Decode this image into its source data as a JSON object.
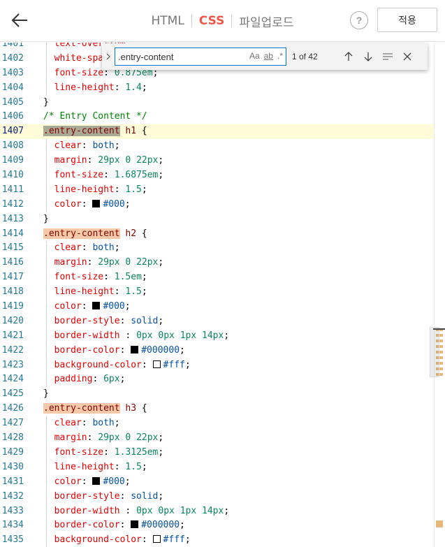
{
  "header": {
    "tabs": [
      {
        "label": "HTML",
        "active": false
      },
      {
        "label": "CSS",
        "active": true
      },
      {
        "label": "파일업로드",
        "active": false
      }
    ],
    "help_label": "?",
    "apply_label": "적용"
  },
  "find": {
    "query": ".entry-content",
    "opt_case": "Aa",
    "opt_word": "ab",
    "opt_regex": ".*",
    "count": "1 of 42"
  },
  "colors": {
    "accent": "#f1564b",
    "match_highlight": "#f8c9a8",
    "current_match": "#a9a995",
    "current_line": "#fdfbd8"
  },
  "editor": {
    "lines": [
      {
        "n": "1401",
        "html": "  <span class='t-prop'>text-overflow</span>"
      },
      {
        "n": "1402",
        "html": "  <span class='t-prop'>white-space</span>"
      },
      {
        "n": "1403",
        "html": "  <span class='t-prop'>font-size</span>: <span class='t-num'>0.875em</span>;"
      },
      {
        "n": "1404",
        "html": "  <span class='t-prop'>line-height</span>: <span class='t-num'>1.4</span>;"
      },
      {
        "n": "1405",
        "html": "}"
      },
      {
        "n": "1406",
        "html": "<span class='t-com'>/* Entry Content */</span>"
      },
      {
        "n": "1407",
        "current": true,
        "html": "<span class='t-sel hl-cur'>.entry-content</span><span class='t-sel'> h1</span> {"
      },
      {
        "n": "1408",
        "html": "  <span class='t-prop'>clear</span>: <span class='t-kw'>both</span>;"
      },
      {
        "n": "1409",
        "html": "  <span class='t-prop'>margin</span>: <span class='t-num'>29px</span> <span class='t-num'>0</span> <span class='t-num'>22px</span>;"
      },
      {
        "n": "1410",
        "html": "  <span class='t-prop'>font-size</span>: <span class='t-num'>1.6875em</span>;"
      },
      {
        "n": "1411",
        "html": "  <span class='t-prop'>line-height</span>: <span class='t-num'>1.5</span>;"
      },
      {
        "n": "1412",
        "html": "  <span class='t-prop'>color</span>: <span class='swatch' style='background:#000'></span><span class='t-kw'>#000</span>;"
      },
      {
        "n": "1413",
        "html": "}"
      },
      {
        "n": "1414",
        "html": "<span class='t-sel hl-match'>.entry-content</span><span class='t-sel'> h2</span> {"
      },
      {
        "n": "1415",
        "html": "  <span class='t-prop'>clear</span>: <span class='t-kw'>both</span>;"
      },
      {
        "n": "1416",
        "html": "  <span class='t-prop'>margin</span>: <span class='t-num'>29px</span> <span class='t-num'>0</span> <span class='t-num'>22px</span>;"
      },
      {
        "n": "1417",
        "html": "  <span class='t-prop'>font-size</span>: <span class='t-num'>1.5em</span>;"
      },
      {
        "n": "1418",
        "html": "  <span class='t-prop'>line-height</span>: <span class='t-num'>1.5</span>;"
      },
      {
        "n": "1419",
        "html": "  <span class='t-prop'>color</span>: <span class='swatch' style='background:#000'></span><span class='t-kw'>#000</span>;"
      },
      {
        "n": "1420",
        "html": "  <span class='t-prop'>border-style</span>: <span class='t-kw'>solid</span>;"
      },
      {
        "n": "1421",
        "html": "  <span class='t-prop'>border-width</span> : <span class='t-num'>0px</span> <span class='t-num'>0px</span> <span class='t-num'>1px</span> <span class='t-num'>14px</span>;"
      },
      {
        "n": "1422",
        "html": "  <span class='t-prop'>border-color</span>: <span class='swatch' style='background:#000'></span><span class='t-kw'>#000000</span>;"
      },
      {
        "n": "1423",
        "html": "  <span class='t-prop'>background-color</span>: <span class='swatch' style='background:#fff'></span><span class='t-kw'>#fff</span>;"
      },
      {
        "n": "1424",
        "html": "  <span class='t-prop'>padding</span>: <span class='t-num'>6px</span>;"
      },
      {
        "n": "1425",
        "html": "}"
      },
      {
        "n": "1426",
        "html": "<span class='t-sel hl-match'>.entry-content</span><span class='t-sel'> h3</span> {"
      },
      {
        "n": "1427",
        "html": "  <span class='t-prop'>clear</span>: <span class='t-kw'>both</span>;"
      },
      {
        "n": "1428",
        "html": "  <span class='t-prop'>margin</span>: <span class='t-num'>29px</span> <span class='t-num'>0</span> <span class='t-num'>22px</span>;"
      },
      {
        "n": "1429",
        "html": "  <span class='t-prop'>font-size</span>: <span class='t-num'>1.3125em</span>;"
      },
      {
        "n": "1430",
        "html": "  <span class='t-prop'>line-height</span>: <span class='t-num'>1.5</span>;"
      },
      {
        "n": "1431",
        "html": "  <span class='t-prop'>color</span>: <span class='swatch' style='background:#000'></span><span class='t-kw'>#000</span>;"
      },
      {
        "n": "1432",
        "html": "  <span class='t-prop'>border-style</span>: <span class='t-kw'>solid</span>;"
      },
      {
        "n": "1433",
        "html": "  <span class='t-prop'>border-width</span> : <span class='t-num'>0px</span> <span class='t-num'>0px</span> <span class='t-num'>1px</span> <span class='t-num'>14px</span>;"
      },
      {
        "n": "1434",
        "html": "  <span class='t-prop'>border-color</span>: <span class='swatch' style='background:#000'></span><span class='t-kw'>#000000</span>;"
      },
      {
        "n": "1435",
        "html": "  <span class='t-prop'>background-color</span>: <span class='swatch' style='background:#fff'></span><span class='t-kw'>#fff</span>;"
      }
    ]
  }
}
